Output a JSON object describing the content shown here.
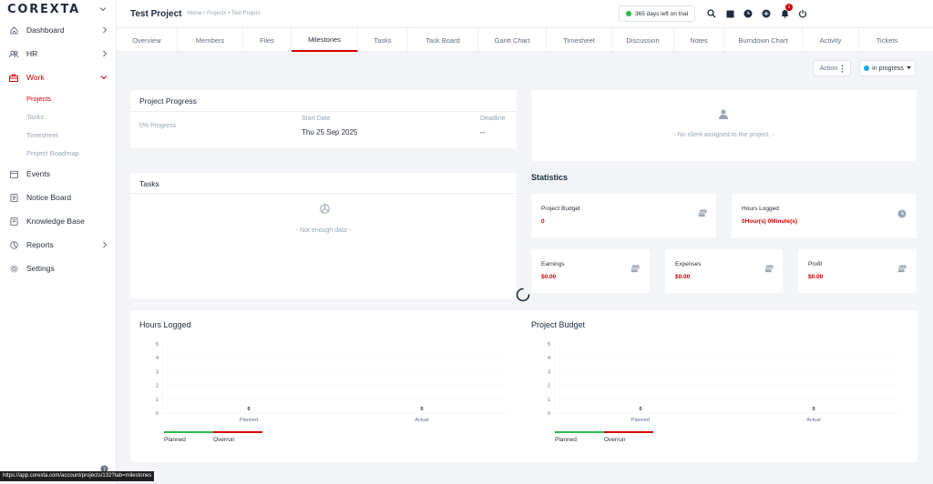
{
  "brand": {
    "logo": "COREXTA"
  },
  "sidebar": {
    "items": [
      {
        "label": "Dashboard",
        "icon": "home-icon"
      },
      {
        "label": "HR",
        "icon": "users-icon"
      },
      {
        "label": "Work",
        "icon": "briefcase-icon"
      },
      {
        "label": "Events",
        "icon": "calendar-icon"
      },
      {
        "label": "Notice Board",
        "icon": "notice-icon"
      },
      {
        "label": "Knowledge Base",
        "icon": "book-icon"
      },
      {
        "label": "Reports",
        "icon": "chart-icon"
      },
      {
        "label": "Settings",
        "icon": "gear-icon"
      }
    ],
    "work_sub": [
      "Projects",
      "Tasks",
      "Timesheet",
      "Project Roadmap"
    ]
  },
  "header": {
    "title": "Test Project",
    "breadcrumb": "Home • Projects • Test Project",
    "trial": "365 days left on trial",
    "notif_count": "1"
  },
  "tabs": [
    "Overview",
    "Members",
    "Files",
    "Milestones",
    "Tasks",
    "Task Board",
    "Gantt Chart",
    "Timesheet",
    "Discussion",
    "Notes",
    "Burndown Chart",
    "Activity",
    "Tickets"
  ],
  "toolbar": {
    "action_label": "Action",
    "status_label": "in progress"
  },
  "progress_card": {
    "title": "Project Progress",
    "progress_text": "0% Progress",
    "start_label": "Start Date",
    "start_value": "Thu 25 Sep 2025",
    "deadline_label": "Deadline",
    "deadline_value": "--"
  },
  "client_card": {
    "message": "- No client assigned to the project. -"
  },
  "tasks_card": {
    "title": "Tasks",
    "empty": "- Not enough data -"
  },
  "statistics": {
    "title": "Statistics",
    "budget": {
      "label": "Project Budget",
      "value": "0"
    },
    "hours": {
      "label": "Hours Logged",
      "value": "0Hour(s) 0Minute(s)"
    },
    "earnings": {
      "label": "Earnings",
      "value": "$0.00"
    },
    "expenses": {
      "label": "Expenses",
      "value": "$0.00"
    },
    "profit": {
      "label": "Profit",
      "value": "$0.00"
    }
  },
  "hours_chart": {
    "title": "Hours Logged",
    "legend": [
      {
        "name": "Planned",
        "color": "#2db84d"
      },
      {
        "name": "Overrun",
        "color": "#d30000"
      }
    ]
  },
  "budget_chart": {
    "title": "Project Budget",
    "legend": [
      {
        "name": "Planned",
        "color": "#2db84d"
      },
      {
        "name": "Overrun",
        "color": "#d30000"
      }
    ]
  },
  "chart_data": [
    {
      "type": "bar",
      "title": "Hours Logged",
      "categories": [
        "Planned",
        "Actual"
      ],
      "values": [
        0,
        0
      ],
      "ylim": [
        0,
        5
      ],
      "yticks": [
        "0",
        "1",
        "2",
        "3",
        "4",
        "5"
      ]
    },
    {
      "type": "bar",
      "title": "Project Budget",
      "categories": [
        "Planned",
        "Actual"
      ],
      "values": [
        0,
        0
      ],
      "ylim": [
        0,
        5
      ],
      "yticks": [
        "0",
        "1",
        "2",
        "3",
        "4",
        "5"
      ]
    }
  ],
  "status_url": "https://app.corexta.com/account/projects/132?tab=milestones"
}
